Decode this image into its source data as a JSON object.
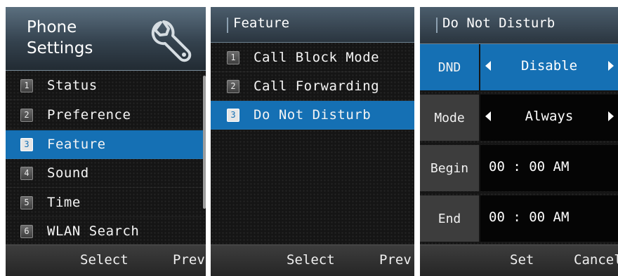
{
  "screen1": {
    "header": {
      "title": "Phone\nSettings",
      "icon": "wrench-icon"
    },
    "items": [
      {
        "num": "1",
        "label": "Status"
      },
      {
        "num": "2",
        "label": "Preference"
      },
      {
        "num": "3",
        "label": "Feature",
        "selected": true
      },
      {
        "num": "4",
        "label": "Sound"
      },
      {
        "num": "5",
        "label": "Time"
      },
      {
        "num": "6",
        "label": "WLAN Search"
      }
    ],
    "softkeys": {
      "left": "Select",
      "right": "Prev"
    }
  },
  "screen2": {
    "header": {
      "title": "Feature"
    },
    "items": [
      {
        "num": "1",
        "label": "Call Block Mode"
      },
      {
        "num": "2",
        "label": "Call Forwarding"
      },
      {
        "num": "3",
        "label": "Do Not Disturb",
        "selected": true
      }
    ],
    "softkeys": {
      "left": "Select",
      "right": "Prev"
    }
  },
  "screen3": {
    "header": {
      "title": "Do Not Disturb"
    },
    "rows": [
      {
        "label": "DND",
        "value": "Disable",
        "selected": true
      },
      {
        "label": "Mode",
        "value": "Always"
      },
      {
        "label": "Begin",
        "value": "00 : 00 AM"
      },
      {
        "label": "End",
        "value": "00 : 00 AM"
      }
    ],
    "softkeys": {
      "left": "Set",
      "right": "Cancel"
    }
  },
  "colors": {
    "highlight": "#1570b4",
    "background": "#151515",
    "header": "#3a4856"
  }
}
